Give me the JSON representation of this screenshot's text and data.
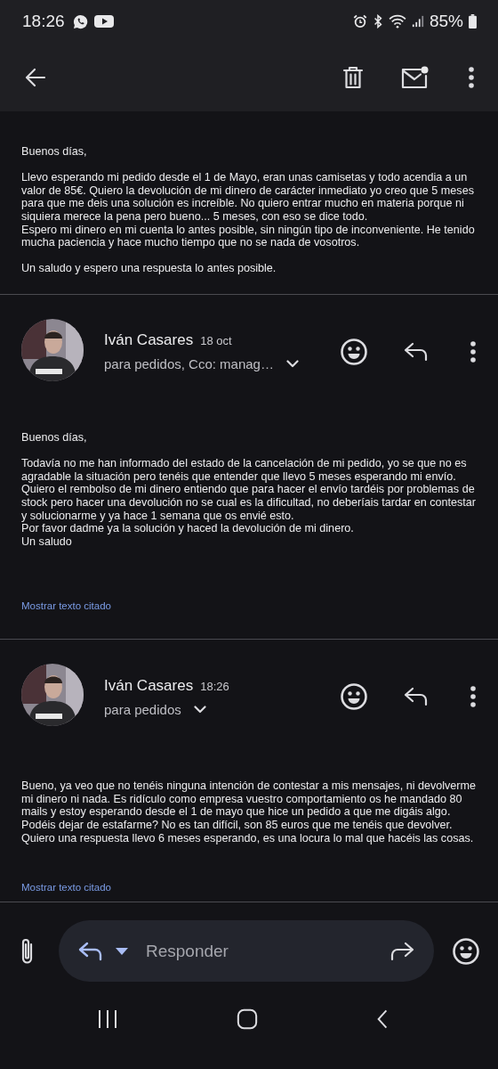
{
  "status_bar": {
    "time": "18:26",
    "battery": "85%"
  },
  "messages": [
    {
      "kind": "continued",
      "paragraphs": [
        "Buenos días,",
        "Llevo esperando mi pedido desde el 1 de Mayo, eran unas camisetas y todo acendia a un valor de 85€. Quiero la devolución de mi dinero de carácter inmediato yo creo que 5 meses para que me deis una solución es increíble. No quiero entrar mucho en materia porque ni siquiera merece la pena pero bueno... 5 meses, con eso se dice todo.\nEspero mi dinero en mi cuenta lo antes posible, sin ningún tipo de inconveniente. He tenido mucha paciencia y hace mucho tiempo que no se nada de vosotros.",
        "Un saludo y espero una respuesta lo antes posible."
      ]
    },
    {
      "kind": "full",
      "sender": "Iván Casares",
      "date": "18 oct",
      "recipients": "para pedidos, Cco: manag…",
      "paragraphs": [
        "Buenos días,",
        "Todavía no me han informado del estado de la cancelación de mi pedido, yo se que no es agradable la situación pero tenéis que entender que llevo 5 meses esperando mi envío.\nQuiero el rembolso de mi dinero entiendo que para hacer el envío tardéis por problemas de stock pero hacer una devolución no se cual es la dificultad, no deberíais tardar en contestar y solucionarme y ya hace 1 semana que os envié esto.\nPor favor dadme ya la solución y haced la devolución de mi dinero.\nUn saludo"
      ],
      "show_quoted": "Mostrar texto citado"
    },
    {
      "kind": "full",
      "sender": "Iván Casares",
      "date": "18:26",
      "recipients": "para pedidos",
      "paragraphs": [
        "Bueno, ya veo que no tenéis ninguna intención de contestar a mis mensajes, ni devolverme mi dinero ni nada. Es ridículo como empresa vuestro comportamiento os he mandado 80 mails y estoy esperando desde el 1 de mayo que hice un pedido a que me digáis algo. Podéis dejar de estafarme? No es tan difícil, son 85 euros que me tenéis que devolver. Quiero una respuesta llevo 6 meses esperando, es una locura lo mal que hacéis las cosas."
      ],
      "show_quoted": "Mostrar texto citado"
    }
  ],
  "reply_bar": {
    "placeholder": "Responder"
  }
}
